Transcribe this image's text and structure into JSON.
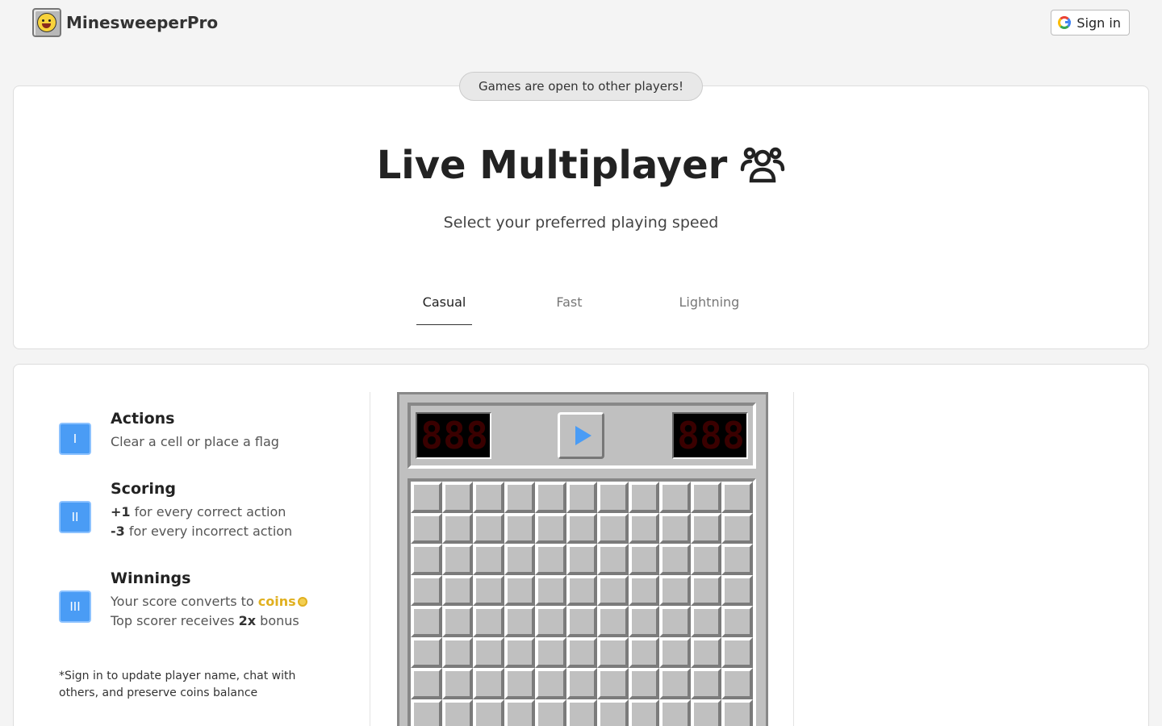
{
  "header": {
    "logo_text": "MinesweeperPro",
    "signin_label": "Sign in"
  },
  "banner": {
    "text": "Games are open to other players!"
  },
  "hero": {
    "title": "Live Multiplayer",
    "subtitle": "Select your preferred playing speed"
  },
  "tabs": [
    {
      "label": "Casual",
      "active": true
    },
    {
      "label": "Fast",
      "active": false
    },
    {
      "label": "Lightning",
      "active": false
    }
  ],
  "rules": [
    {
      "badge": "I",
      "title": "Actions",
      "lines": [
        "Clear a cell or place a flag"
      ]
    },
    {
      "badge": "II",
      "title": "Scoring",
      "lines": [
        {
          "bold": "+1",
          "text": " for every correct action"
        },
        {
          "bold": "-3",
          "text": " for every incorrect action"
        }
      ]
    },
    {
      "badge": "III",
      "title": "Winnings",
      "lines": [
        {
          "text": "Your score converts to ",
          "coins": "coins"
        },
        {
          "text": "Top scorer receives ",
          "bold": "2x",
          "after": " bonus"
        }
      ]
    }
  ],
  "note": "*Sign in to update player name, chat with others, and preserve coins balance",
  "colors": {
    "accent_blue": "#4a9cf5",
    "coin_gold": "#e0b020",
    "counter_red": "#ff2a1a"
  },
  "icons": {
    "logo": "smiley-face-icon",
    "signin": "google-g-icon",
    "title": "user-group-icon",
    "play": "play-icon",
    "coin": "coin-icon"
  }
}
